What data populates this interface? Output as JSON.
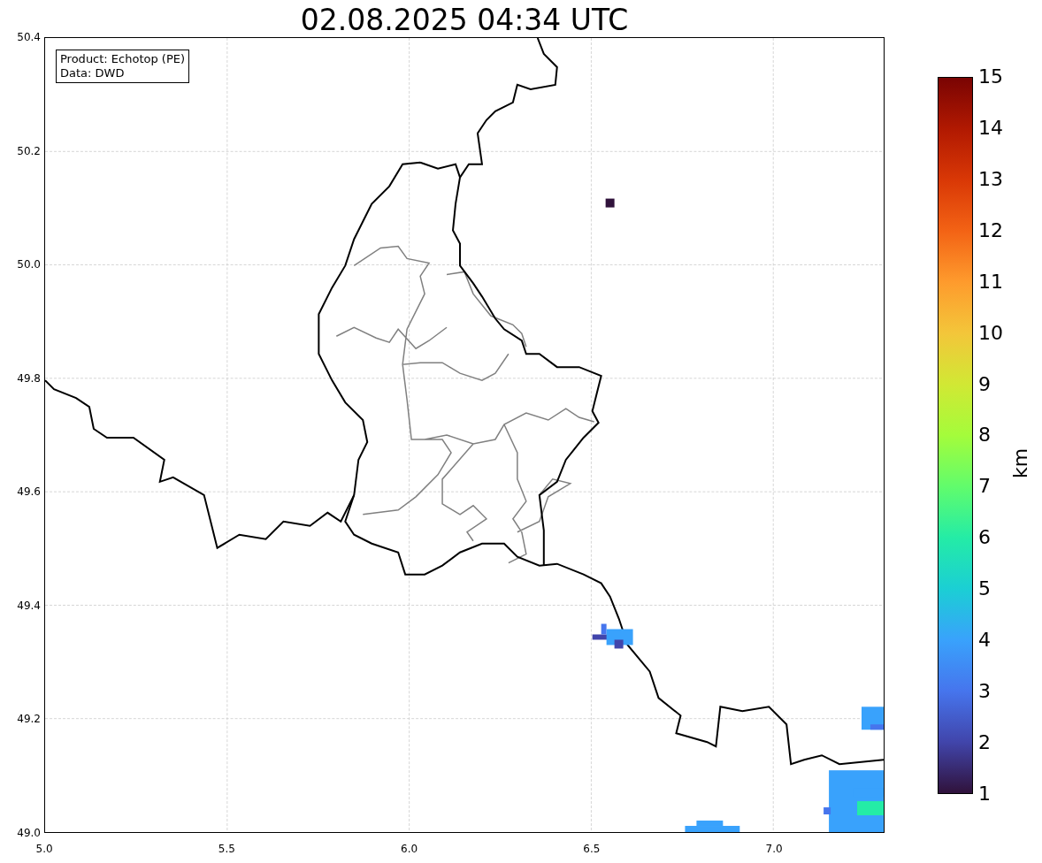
{
  "title": "02.08.2025 04:34 UTC",
  "legend": [
    "Product: Echotop (PE)",
    "Data: DWD"
  ],
  "y_ticks": [
    "50.4",
    "50.2",
    "50.0",
    "49.8",
    "49.6",
    "49.4",
    "49.2",
    "49.0"
  ],
  "x_ticks": [
    "5.0",
    "5.5",
    "6.0",
    "6.5",
    "7.0"
  ],
  "colorbar": {
    "label": "km",
    "ticks": [
      "15",
      "14",
      "13",
      "12",
      "11",
      "10",
      "9",
      "8",
      "7",
      "6",
      "5",
      "4",
      "3",
      "2",
      "1"
    ]
  }
}
